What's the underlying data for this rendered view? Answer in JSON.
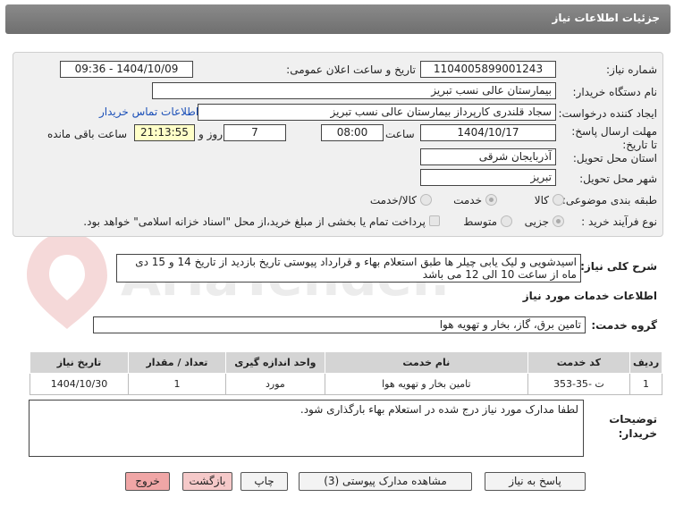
{
  "header": {
    "title": "جزئیات اطلاعات نیاز"
  },
  "form": {
    "need_number_label": "شماره نیاز:",
    "need_number": "1104005899001243",
    "announce_label": "تاریخ و ساعت اعلان عمومی:",
    "announce_value": "1404/10/09 - 09:36",
    "buyer_label": "نام دستگاه خریدار:",
    "buyer_value": "بیمارستان عالی نسب تبریز",
    "creator_label": "ایجاد کننده درخواست:",
    "creator_value": "سجاد قلندری کارپرداز بیمارستان عالی نسب تبریز",
    "contact_link": "اطلاعات تماس خریدار",
    "deadline_label": "مهلت ارسال پاسخ: تا تاریخ:",
    "deadline_date": "1404/10/17",
    "time_label": "ساعت",
    "deadline_time": "08:00",
    "days_value": "7",
    "days_label": "روز و",
    "remaining_value": "21:13:55",
    "remaining_label": "ساعت باقی مانده",
    "province_label": "استان محل تحویل:",
    "province_value": "آذربایجان شرقی",
    "city_label": "شهر محل تحویل:",
    "city_value": "تبریز",
    "category_label": "طبقه بندی موضوعی:",
    "category_options": [
      "کالا",
      "خدمت",
      "کالا/خدمت"
    ],
    "process_label": "نوع فرآیند خرید :",
    "process_options": [
      "جزیی",
      "متوسط"
    ],
    "payment_note": "پرداخت تمام یا بخشی از مبلغ خرید،از محل \"اسناد خزانه اسلامی\" خواهد بود."
  },
  "description": {
    "label": "شرح کلی نیاز:",
    "text": "اسیدشویی و لیک یابی چیلر ها طبق استعلام بهاء و قرارداد پیوستی تاریخ بازدید از تاریخ 14 و 15 دی ماه از ساعت 10 الی 12 می باشد"
  },
  "services": {
    "section_title": "اطلاعات خدمات مورد نیاز",
    "group_label": "گروه خدمت:",
    "group_value": "تامین برق، گاز، بخار و تهویه هوا",
    "columns": [
      "ردیف",
      "کد خدمت",
      "نام خدمت",
      "واحد اندازه گیری",
      "تعداد / مقدار",
      "تاریخ نیاز"
    ],
    "rows": [
      [
        "1",
        "ت -35-353",
        "تامین بخار و تهویه هوا",
        "مورد",
        "1",
        "1404/10/30"
      ]
    ]
  },
  "notes": {
    "label": "توضیحات خریدار:",
    "text": "لطفا مدارک مورد نیاز درج شده در استعلام بهاء بارگذاری شود."
  },
  "buttons": {
    "reply": "پاسخ به نیاز",
    "attachments": "مشاهده مدارک پیوستی (3)",
    "print": "چاپ",
    "back": "بازگشت",
    "exit": "خروج"
  },
  "watermark": {
    "text": "AriaTender.net"
  },
  "colors": {
    "header": "#7a7a7a",
    "panel": "#f0f0f0",
    "link": "#1a4fb8",
    "remaining_bg": "#ffffc8",
    "exit_bg": "#f5c9c9"
  }
}
